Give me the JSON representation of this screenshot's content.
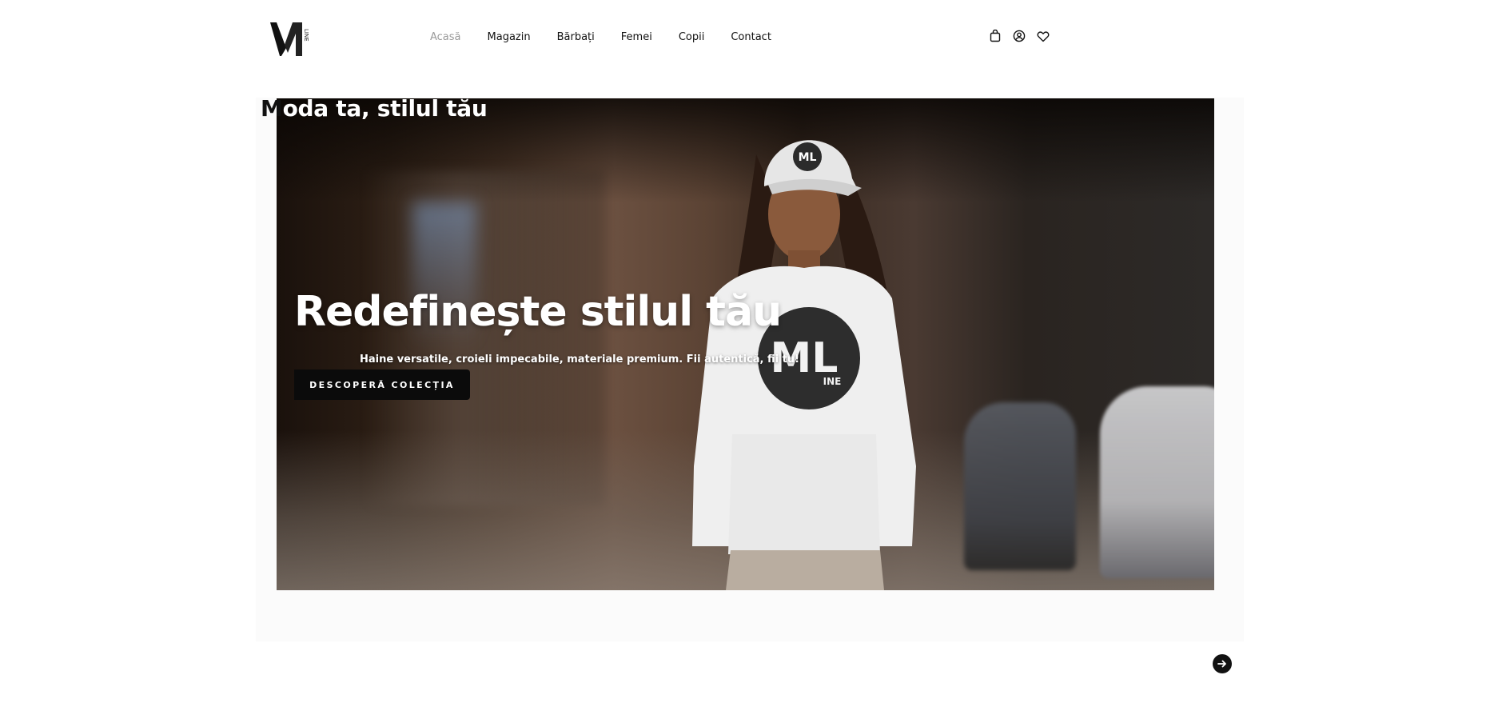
{
  "brand": {
    "logo_alt": "M LINE"
  },
  "nav": {
    "items": [
      {
        "label": "Acasă",
        "active": true
      },
      {
        "label": "Magazin"
      },
      {
        "label": "Bărbați"
      },
      {
        "label": "Femei"
      },
      {
        "label": "Copii"
      },
      {
        "label": "Contact"
      }
    ]
  },
  "header_icons": [
    "shopping-bag-icon",
    "account-icon",
    "wishlist-heart-icon"
  ],
  "hero": {
    "eyebrow_first": "M",
    "eyebrow_rest": "oda ta, stilul tău",
    "title": "Redefinește stilul tău",
    "subtitle": "Haine versatile, croieli impecabile, materiale premium. Fii autentică, fii tu!",
    "cta_label": "DESCOPERĂ COLECȚIA",
    "shirt_logo": "ML",
    "shirt_logo_sub": "INE",
    "cap_logo": "ML"
  },
  "carousel": {
    "next_icon": "arrow-right-icon"
  },
  "colors": {
    "accent": "#111111",
    "nav_active": "#9a9a9a",
    "background": "#ffffff"
  }
}
